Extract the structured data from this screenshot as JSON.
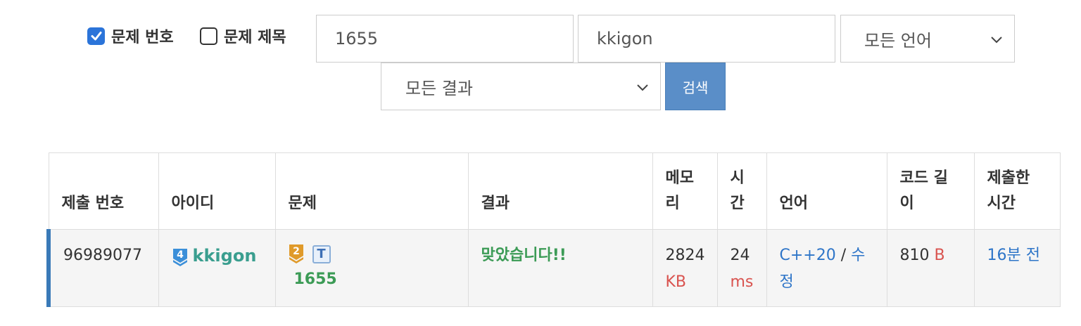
{
  "filters": {
    "problem_number_label": "문제 번호",
    "problem_number_checked": true,
    "problem_title_label": "문제 제목",
    "problem_title_checked": false,
    "problem_input": "1655",
    "user_input": "kkigon",
    "language_select": "모든 언어",
    "result_select": "모든 결과",
    "search_button": "검색"
  },
  "table": {
    "headers": [
      "제출 번호",
      "아이디",
      "문제",
      "결과",
      "메모리",
      "시간",
      "언어",
      "코드 길이",
      "제출한 시간"
    ],
    "rows": [
      {
        "submission_id": "96989077",
        "user_tier": "4",
        "user": "kkigon",
        "problem_tier": "2",
        "problem_tag": "T",
        "problem_id": "1655",
        "result": "맞았습니다!!",
        "memory": "2824",
        "memory_unit": "KB",
        "time": "24",
        "time_unit": "ms",
        "language": "C++20",
        "separator": "/",
        "edit": "수정",
        "code_length": "810",
        "code_unit": "B",
        "submitted": "16분 전"
      }
    ]
  },
  "colors": {
    "accent": "#2b74d9",
    "search_button": "#5a8ec8",
    "accepted": "#3c9b56",
    "user": "#3a9e8f",
    "unit": "#d9534f",
    "link": "#2e75c8",
    "row_marker": "#3a7ab8"
  },
  "icons": [
    "checkbox-checked-icon",
    "checkbox-unchecked-icon",
    "chevron-down-icon",
    "user-tier-badge-icon",
    "problem-tier-badge-icon",
    "problem-tag-icon"
  ]
}
